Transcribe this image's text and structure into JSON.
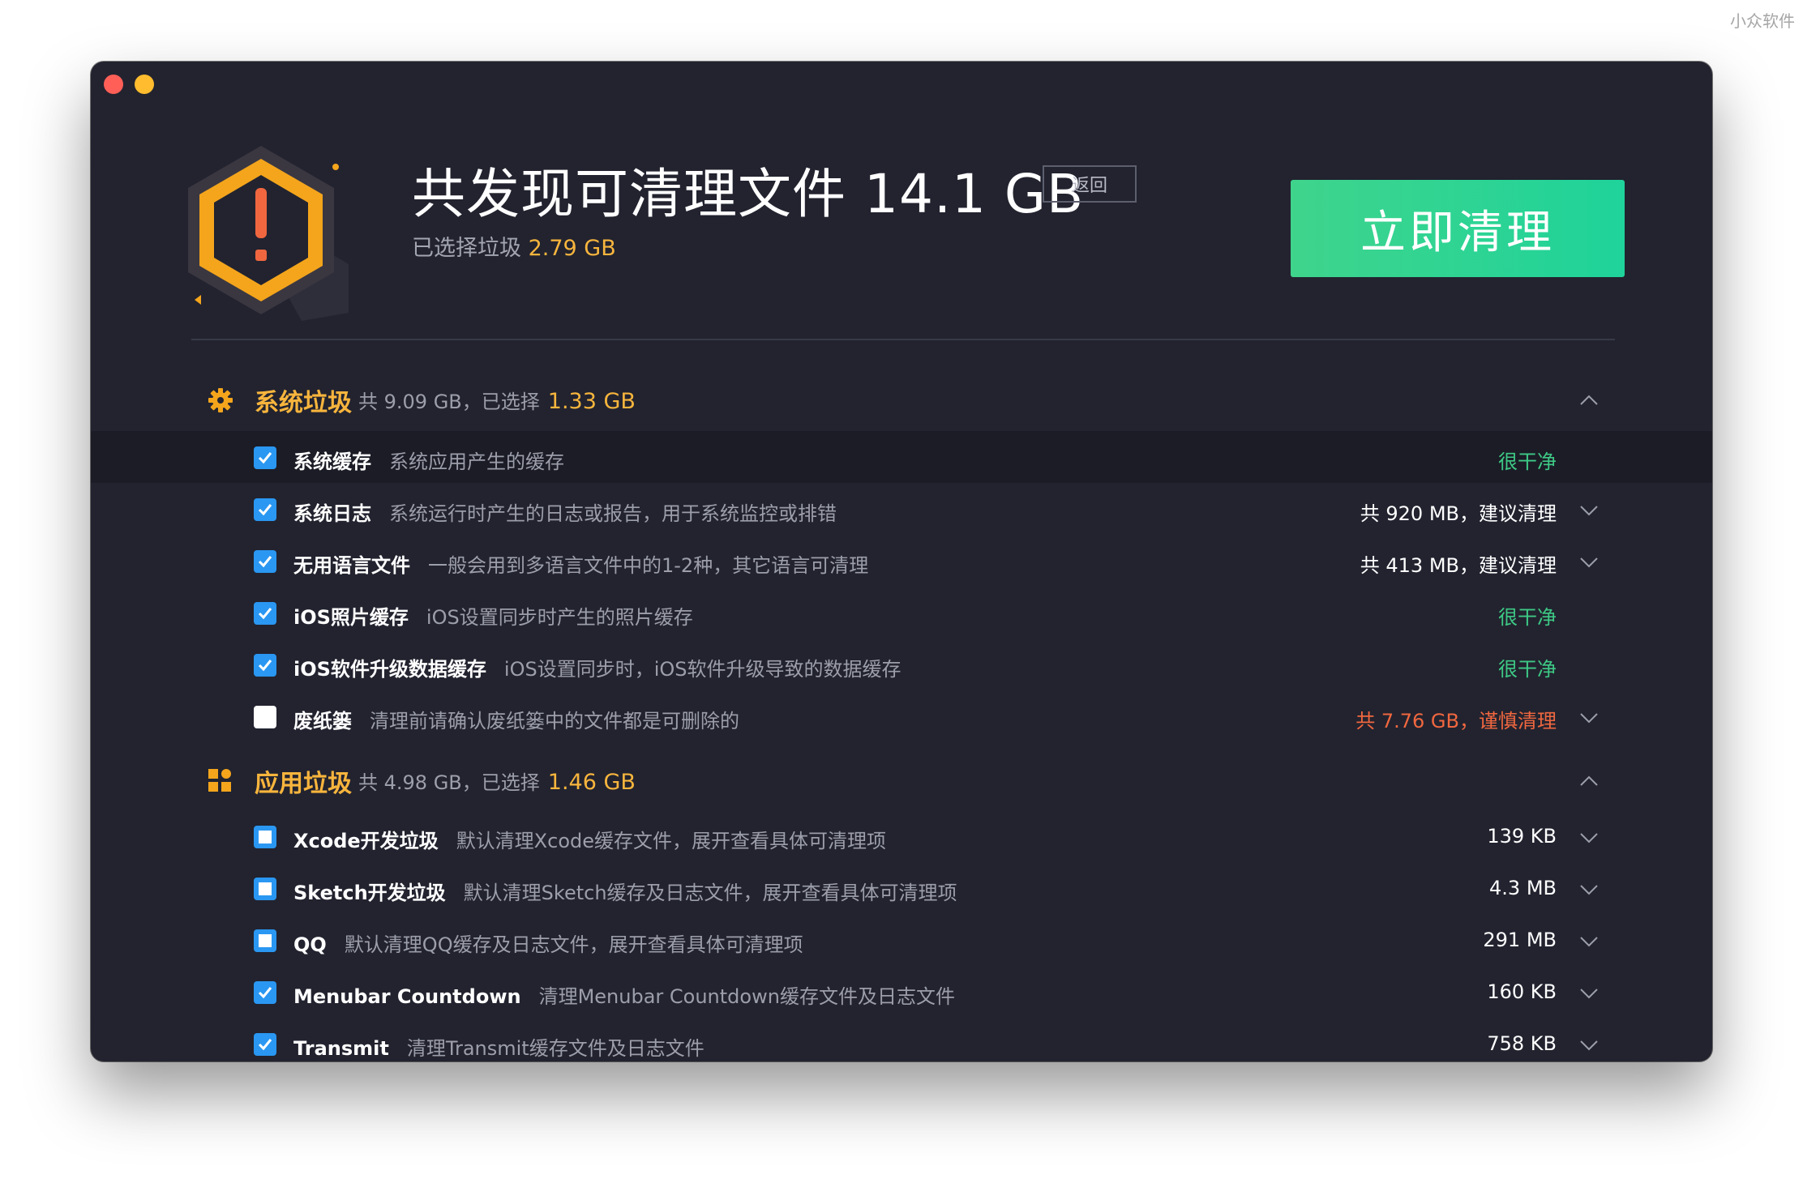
{
  "watermark": "小众软件",
  "header": {
    "title": "共发现可清理文件 14.1 GB",
    "back_label": "返回",
    "selected_prefix": "已选择垃圾",
    "selected_value": "2.79 GB",
    "clean_button": "立即清理"
  },
  "sections": [
    {
      "title": "系统垃圾",
      "summary": "共 9.09 GB，已选择",
      "selected": "1.33 GB",
      "icon": "gear-icon",
      "items": [
        {
          "name": "系统缓存",
          "desc": "系统应用产生的缓存",
          "status": "很干净",
          "checkbox": "checked"
        },
        {
          "name": "系统日志",
          "desc": "系统运行时产生的日志或报告，用于系统监控或排错",
          "status": "共 920 MB，建议清理",
          "checkbox": "checked"
        },
        {
          "name": "无用语言文件",
          "desc": "一般会用到多语言文件中的1-2种，其它语言可清理",
          "status": "共 413 MB，建议清理",
          "checkbox": "checked"
        },
        {
          "name": "iOS照片缓存",
          "desc": "iOS设置同步时产生的照片缓存",
          "status": "很干净",
          "checkbox": "checked"
        },
        {
          "name": "iOS软件升级数据缓存",
          "desc": "iOS设置同步时，iOS软件升级导致的数据缓存",
          "status": "很干净",
          "checkbox": "checked"
        },
        {
          "name": "废纸篓",
          "desc": "清理前请确认废纸篓中的文件都是可删除的",
          "status": "共 7.76 GB，谨慎清理",
          "checkbox": "unchecked"
        }
      ]
    },
    {
      "title": "应用垃圾",
      "summary": "共 4.98 GB，已选择",
      "selected": "1.46 GB",
      "icon": "apps-grid-icon",
      "items": [
        {
          "name": "Xcode开发垃圾",
          "desc": "默认清理Xcode缓存文件，展开查看具体可清理项",
          "status": "139 KB",
          "checkbox": "partial"
        },
        {
          "name": "Sketch开发垃圾",
          "desc": "默认清理Sketch缓存及日志文件，展开查看具体可清理项",
          "status": "4.3 MB",
          "checkbox": "partial"
        },
        {
          "name": "QQ",
          "desc": "默认清理QQ缓存及日志文件，展开查看具体可清理项",
          "status": "291 MB",
          "checkbox": "partial"
        },
        {
          "name": "Menubar Countdown",
          "desc": "清理Menubar Countdown缓存文件及日志文件",
          "status": "160 KB",
          "checkbox": "checked"
        },
        {
          "name": "Transmit",
          "desc": "清理Transmit缓存文件及日志文件",
          "status": "758 KB",
          "checkbox": "checked"
        }
      ]
    }
  ],
  "colors": {
    "window_bg": "#22232f",
    "accent_orange": "#f8b53d",
    "clean_green": "#3ec985",
    "warn_red": "#f0673f",
    "checkbox_blue": "#2a97f2",
    "button_green": "#23d394"
  }
}
